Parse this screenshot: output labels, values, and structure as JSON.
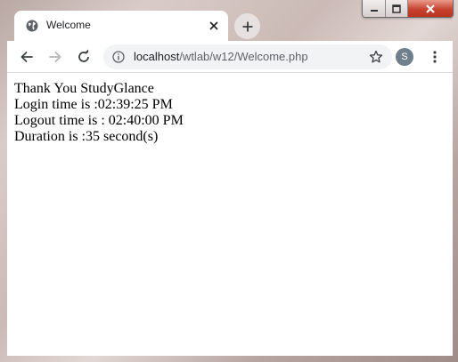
{
  "window": {
    "controls": [
      "minimize",
      "maximize",
      "close"
    ]
  },
  "tab": {
    "title": "Welcome",
    "icon": "globe-icon"
  },
  "toolbar": {
    "url_host": "localhost",
    "url_path": "/wtlab/w12/Welcome.php",
    "profile_initial": "S"
  },
  "page": {
    "lines": [
      "Thank You StudyGlance",
      "Login time is :02:39:25 PM",
      "Logout time is : 02:40:00 PM",
      "Duration is :35 second(s)"
    ]
  },
  "colors": {
    "close_button": "#c7432f",
    "avatar": "#6f7f8c",
    "omnibox": "#f1f3f4"
  }
}
